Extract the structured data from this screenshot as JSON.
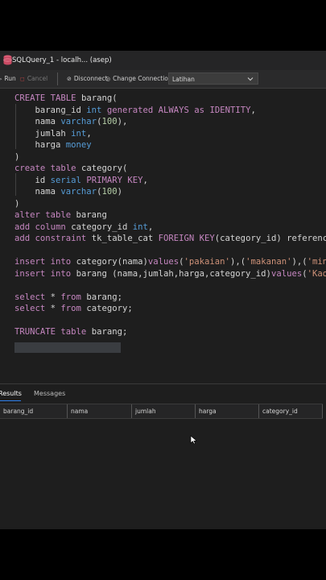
{
  "window": {
    "title": "SQLQuery_1 - localh... (asep)",
    "icon": "database-icon"
  },
  "toolbar": {
    "run_label": "Run",
    "cancel_label": "Cancel",
    "disconnect_label": "Disconnect",
    "change_connection_label": "Change Connection",
    "database_selected": "Latihan"
  },
  "editor": {
    "lines": [
      "CREATE TABLE barang(",
      "    barang_id int generated ALWAYS as IDENTITY,",
      "    nama varchar(100),",
      "    jumlah int,",
      "    harga money",
      ")",
      "create table category(",
      "    id serial PRIMARY KEY,",
      "    nama varchar(100)",
      ")",
      "alter table barang",
      "add column category_id int,",
      "add constraint tk_table_cat FOREIGN KEY(category_id) referenc",
      "",
      "insert into category(nama)values('pakaian'),('makanan'),('min",
      "insert into barang (nama,jumlah,harga,category_id)values('Kaos",
      "",
      "select * from barang;",
      "select * from category;",
      "",
      "TRUNCATE table barang;"
    ]
  },
  "results": {
    "tabs": [
      "Results",
      "Messages"
    ],
    "columns": [
      "barang_id",
      "nama",
      "jumlah",
      "harga",
      "category_id"
    ]
  },
  "colors": {
    "keyword": "#c586c0",
    "type": "#569cd6",
    "function": "#dcdcaa",
    "number": "#b5cea8",
    "string": "#ce9178",
    "accent": "#2f80ed"
  }
}
